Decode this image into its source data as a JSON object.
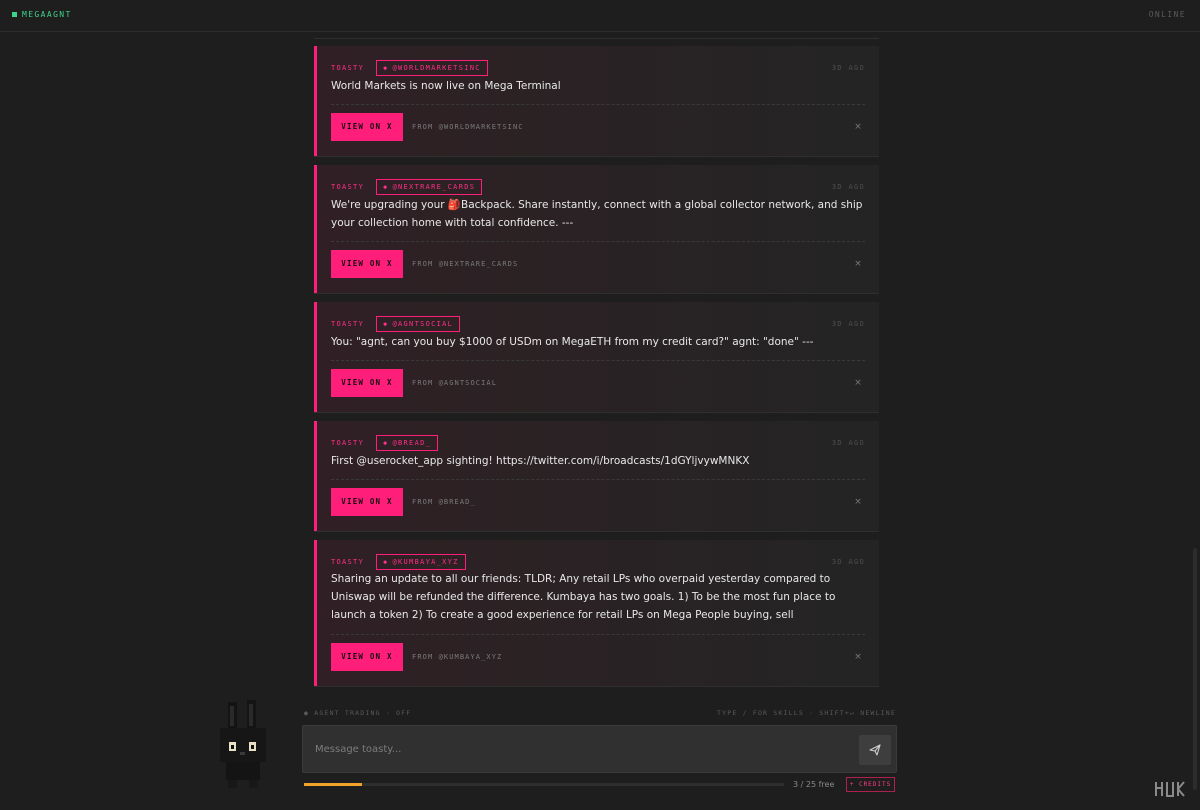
{
  "app": {
    "name": "MEGAAGNT",
    "status": "ONLINE"
  },
  "colors": {
    "accent": "#ff1f7a",
    "brand": "#3ed38a",
    "progress": "#f0a22a"
  },
  "feed": [
    {
      "author": "TOASTY",
      "handle": "@WORLDMARKETSINC",
      "time": "3D AGO",
      "text": "World Markets is now live on Mega Terminal",
      "view_label": "VIEW ON X",
      "from": "FROM @WORLDMARKETSINC",
      "dismiss": "×"
    },
    {
      "author": "TOASTY",
      "handle": "@NEXTRARE_CARDS",
      "time": "3D AGO",
      "text": "We're upgrading your 🎒Backpack. Share instantly, connect with a global collector network, and ship your collection home with total confidence. ---",
      "view_label": "VIEW ON X",
      "from": "FROM @NEXTRARE_CARDS",
      "dismiss": "×"
    },
    {
      "author": "TOASTY",
      "handle": "@AGNTSOCIAL",
      "time": "3D AGO",
      "text": "You: \"agnt, can you buy $1000 of USDm on MegaETH from my credit card?\" agnt: \"done\" ---",
      "view_label": "VIEW ON X",
      "from": "FROM @AGNTSOCIAL",
      "dismiss": "×"
    },
    {
      "author": "TOASTY",
      "handle": "@BREAD_",
      "time": "3D AGO",
      "text": "First @userocket_app sighting! https://twitter.com/i/broadcasts/1dGYljvywMNKX",
      "view_label": "VIEW ON X",
      "from": "FROM @BREAD_",
      "dismiss": "×"
    },
    {
      "author": "TOASTY",
      "handle": "@KUMBAYA_XYZ",
      "time": "3D AGO",
      "text": "Sharing an update to all our friends: TLDR; Any retail LPs who overpaid yesterday compared to Uniswap will be refunded the difference. Kumbaya has two goals. 1) To be the most fun place to launch a token 2) To create a good experience for retail LPs on Mega People buying, sell",
      "view_label": "VIEW ON X",
      "from": "FROM @KUMBAYA_XYZ",
      "dismiss": "×"
    }
  ],
  "composer": {
    "trading_status": "● AGENT TRADING · OFF",
    "hints": "TYPE / FOR SKILLS · SHIFT+↵ NEWLINE",
    "placeholder": "Message toasty...",
    "send_icon": "send-icon",
    "quota": "3 / 25 free",
    "quota_fraction": 0.12,
    "credits_label": "+ CREDITS"
  }
}
